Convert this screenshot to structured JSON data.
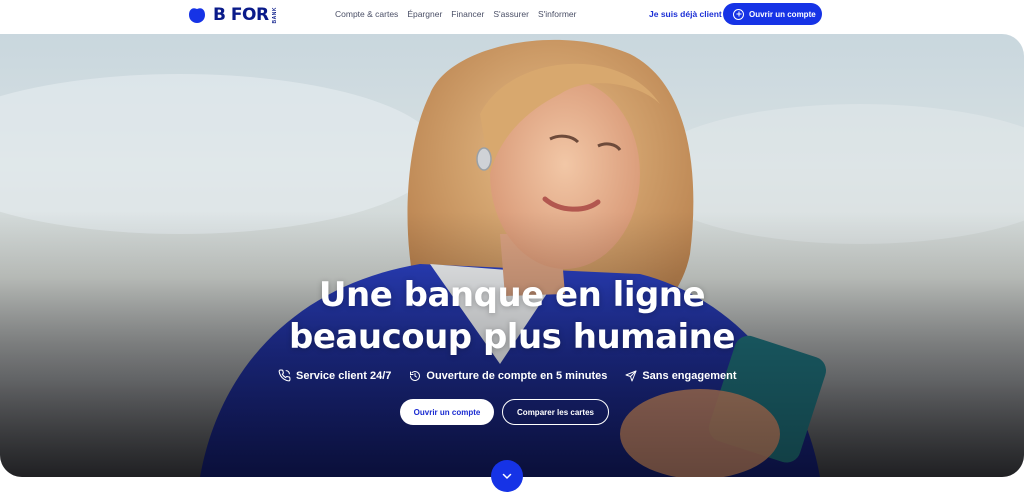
{
  "brand": {
    "name": "B FOR",
    "sub": "BANK",
    "primary_color": "#1633e6",
    "dark_color": "#0a1b8a"
  },
  "nav": {
    "items": [
      "Compte & cartes",
      "Épargner",
      "Financer",
      "S'assurer",
      "S'informer"
    ],
    "login": "Je suis déjà client",
    "open_account": "Ouvrir un compte"
  },
  "hero": {
    "headline_line1": "Une banque en ligne",
    "headline_line2": "beaucoup plus humaine",
    "features": [
      {
        "icon": "phone-icon",
        "label": "Service client 24/7"
      },
      {
        "icon": "clock-icon",
        "label": "Ouverture de compte en 5 minutes"
      },
      {
        "icon": "send-icon",
        "label": "Sans engagement"
      }
    ],
    "primary_cta": "Ouvrir un compte",
    "secondary_cta": "Comparer les cartes"
  },
  "scroll": {
    "icon": "chevron-down-icon"
  }
}
